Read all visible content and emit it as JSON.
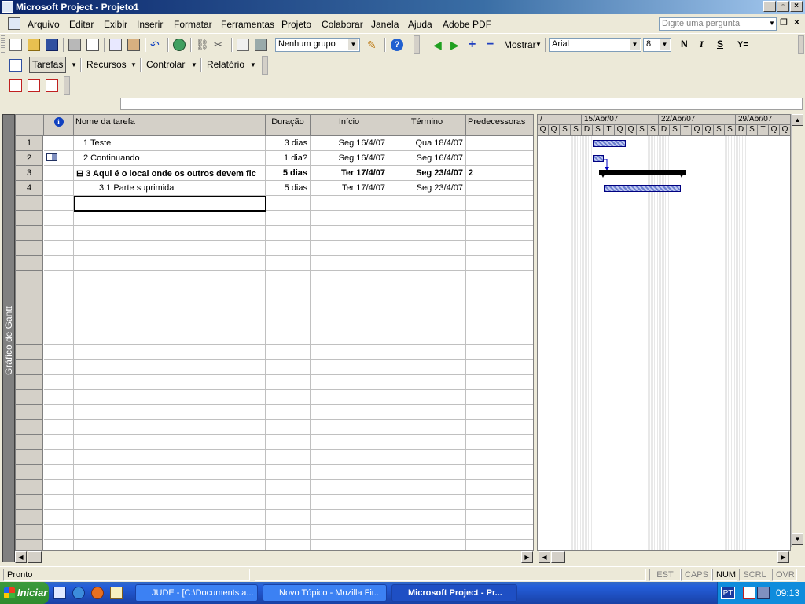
{
  "window": {
    "title": "Microsoft Project - Projeto1"
  },
  "menu": {
    "items": [
      "Arquivo",
      "Editar",
      "Exibir",
      "Inserir",
      "Formatar",
      "Ferramentas",
      "Projeto",
      "Colaborar",
      "Janela",
      "Ajuda",
      "Adobe PDF"
    ],
    "ask_placeholder": "Digite uma pergunta"
  },
  "toolbar": {
    "group_combo": "Nenhum grupo",
    "show_label": "Mostrar",
    "font_combo": "Arial",
    "size_combo": "8",
    "bold": "N",
    "italic": "I",
    "underline": "S"
  },
  "guide_toolbar": {
    "tasks": "Tarefas",
    "resources": "Recursos",
    "track": "Controlar",
    "report": "Relatório"
  },
  "view_bar": {
    "label": "Gráfico de Gantt"
  },
  "table": {
    "headers": {
      "info": "i",
      "name": "Nome da tarefa",
      "duration": "Duração",
      "start": "Início",
      "finish": "Término",
      "predecessors": "Predecessoras"
    },
    "rows": [
      {
        "id": "1",
        "name": "1 Teste",
        "duration": "3 dias",
        "start": "Seg 16/4/07",
        "finish": "Qua 18/4/07",
        "pred": ""
      },
      {
        "id": "2",
        "name": "2 Continuando",
        "duration": "1 dia?",
        "start": "Seg 16/4/07",
        "finish": "Seg 16/4/07",
        "pred": ""
      },
      {
        "id": "3",
        "name": "3 Aqui é o local onde os outros devem fic",
        "duration": "5 dias",
        "start": "Ter 17/4/07",
        "finish": "Seg 23/4/07",
        "pred": "2"
      },
      {
        "id": "4",
        "name": "3.1 Parte suprimida",
        "duration": "5 dias",
        "start": "Ter 17/4/07",
        "finish": "Seg 23/4/07",
        "pred": ""
      }
    ]
  },
  "gantt": {
    "weeks": [
      "15/Abr/07",
      "22/Abr/07",
      "29/Abr/07"
    ],
    "days": [
      "Q",
      "Q",
      "S",
      "S",
      "D",
      "S",
      "T",
      "Q",
      "Q",
      "S",
      "S",
      "D",
      "S",
      "T",
      "Q",
      "Q",
      "S",
      "S",
      "D",
      "S",
      "T",
      "Q",
      "Q"
    ]
  },
  "status": {
    "ready": "Pronto",
    "est": "EST",
    "caps": "CAPS",
    "num": "NUM",
    "scrl": "SCRL",
    "ovr": "OVR"
  },
  "taskbar": {
    "start": "Iniciar",
    "tasks": [
      "JUDE - [C:\\Documents a...",
      "Novo Tópico - Mozilla Fir...",
      "Microsoft Project - Pr..."
    ],
    "lang": "PT",
    "clock": "09:13"
  }
}
